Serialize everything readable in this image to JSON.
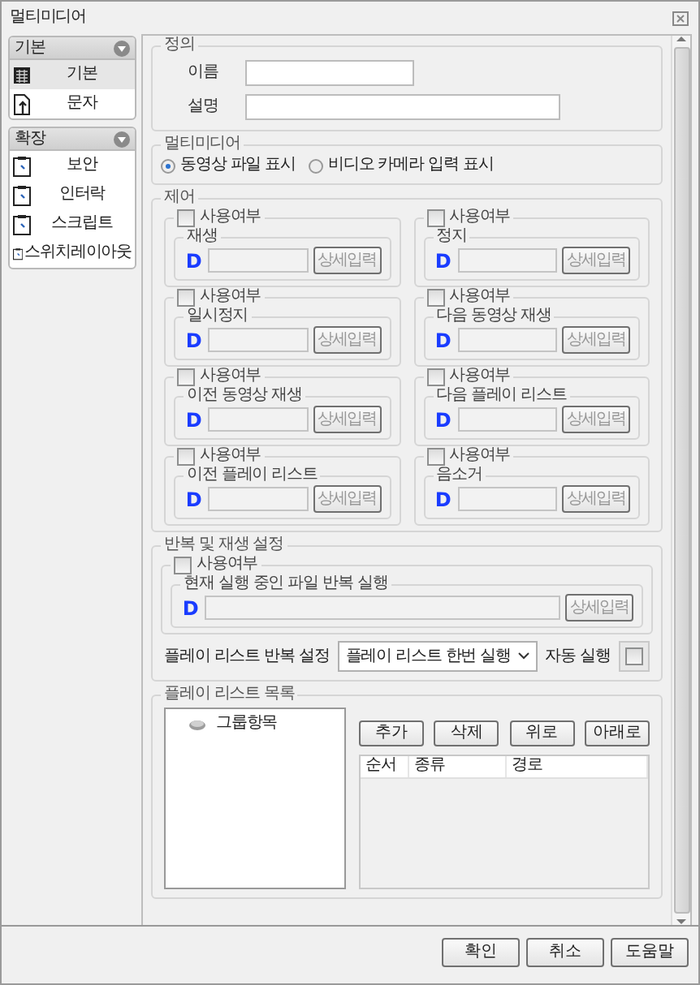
{
  "window": {
    "title": "멀티미디어"
  },
  "sidebar": {
    "groups": [
      {
        "title": "기본",
        "expanded": true,
        "items": [
          {
            "label": "기본",
            "kind": "table",
            "selected": true
          },
          {
            "label": "문자",
            "kind": "text",
            "selected": false
          }
        ]
      },
      {
        "title": "확장",
        "expanded": true,
        "items": [
          {
            "label": "보안",
            "kind": "extension",
            "selected": false
          },
          {
            "label": "인터락",
            "kind": "extension",
            "selected": false
          },
          {
            "label": "스크립트",
            "kind": "extension",
            "selected": false
          },
          {
            "label": "스위치레이아웃",
            "kind": "extension",
            "selected": false
          }
        ]
      }
    ]
  },
  "definition": {
    "title": "정의",
    "fields": [
      {
        "label": "이름"
      },
      {
        "label": "설명"
      }
    ]
  },
  "multimedia": {
    "title": "멀티미디어",
    "options": [
      {
        "label": "동영상 파일 표시",
        "selected": true
      },
      {
        "label": "비디오 카메라 입력 표시",
        "selected": false
      }
    ]
  },
  "control": {
    "title": "제어",
    "items": [
      {
        "use_label": "사용여부",
        "checked": false,
        "name": "재생",
        "prefix": "D",
        "button": "상세입력"
      },
      {
        "use_label": "사용여부",
        "checked": false,
        "name": "정지",
        "prefix": "D",
        "button": "상세입력"
      },
      {
        "use_label": "사용여부",
        "checked": false,
        "name": "일시정지",
        "prefix": "D",
        "button": "상세입력"
      },
      {
        "use_label": "사용여부",
        "checked": false,
        "name": "다음 동영상 재생",
        "prefix": "D",
        "button": "상세입력"
      },
      {
        "use_label": "사용여부",
        "checked": false,
        "name": "이전 동영상 재생",
        "prefix": "D",
        "button": "상세입력"
      },
      {
        "use_label": "사용여부",
        "checked": false,
        "name": "다음 플레이 리스트",
        "prefix": "D",
        "button": "상세입력"
      },
      {
        "use_label": "사용여부",
        "checked": false,
        "name": "이전 플레이 리스트",
        "prefix": "D",
        "button": "상세입력"
      },
      {
        "use_label": "사용여부",
        "checked": false,
        "name": "음소거",
        "prefix": "D",
        "button": "상세입력"
      }
    ]
  },
  "repeat": {
    "title": "반복 및 재생 설정",
    "use_label": "사용여부",
    "checked": false,
    "group": "현재 실행 중인 파일 반복 실행",
    "prefix": "D",
    "button": "상세입력",
    "repeat_label": "플레이 리스트 반복 설정",
    "repeat_value": "플레이 리스트 한번 실행",
    "auto_label": "자동 실행",
    "auto_checked": false
  },
  "playlist": {
    "title": "플레이 리스트 목록",
    "tree": [
      {
        "label": "그룹항목"
      }
    ],
    "buttons": [
      "추가",
      "삭제",
      "위로",
      "아래로"
    ],
    "columns": [
      "순서",
      "종류",
      "경로"
    ]
  },
  "footer": {
    "buttons": [
      "확인",
      "취소",
      "도움말"
    ]
  }
}
